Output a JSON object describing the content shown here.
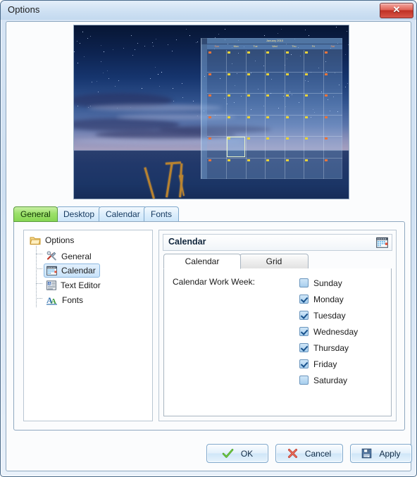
{
  "window": {
    "title": "Options",
    "close_label": "✕",
    "close_icon": "close-icon"
  },
  "preview": {
    "name": "calendar-preview-image",
    "description": "Night seascape with semi-transparent calendar overlay",
    "overlay_title": "January 2010",
    "day_headers": [
      "Sun",
      "Mon",
      "Tue",
      "Wed",
      "Thu",
      "Fri",
      "Sat"
    ]
  },
  "outer_tabs": [
    {
      "label": "General",
      "active": true
    },
    {
      "label": "Desktop",
      "active": false
    },
    {
      "label": "Calendar",
      "active": false
    },
    {
      "label": "Fonts",
      "active": false
    }
  ],
  "tree": {
    "root": {
      "label": "Options",
      "icon": "folder-icon"
    },
    "items": [
      {
        "label": "General",
        "icon": "tools-icon",
        "selected": false
      },
      {
        "label": "Calendar",
        "icon": "calendar-icon",
        "selected": true
      },
      {
        "label": "Text Editor",
        "icon": "text-editor-icon",
        "selected": false
      },
      {
        "label": "Fonts",
        "icon": "fonts-icon",
        "selected": false
      }
    ]
  },
  "panel": {
    "header_title": "Calendar",
    "header_icon": "calendar-icon",
    "inner_tabs": [
      {
        "label": "Calendar",
        "active": true
      },
      {
        "label": "Grid",
        "active": false
      }
    ],
    "field_label": "Calendar Work Week:",
    "work_week": [
      {
        "label": "Sunday",
        "checked": false
      },
      {
        "label": "Monday",
        "checked": true
      },
      {
        "label": "Tuesday",
        "checked": true
      },
      {
        "label": "Wednesday",
        "checked": true
      },
      {
        "label": "Thursday",
        "checked": true
      },
      {
        "label": "Friday",
        "checked": true
      },
      {
        "label": "Saturday",
        "checked": false
      }
    ]
  },
  "footer": {
    "ok_label": "OK",
    "cancel_label": "Cancel",
    "apply_label": "Apply",
    "ok_icon": "green-check-icon",
    "cancel_icon": "red-x-icon",
    "apply_icon": "floppy-disk-icon"
  },
  "colors": {
    "accent_blue": "#2f6fad",
    "active_tab_green": "#9ce06a",
    "close_red": "#bf3124",
    "ok_green": "#3f9c20",
    "cancel_red": "#d9452f"
  }
}
